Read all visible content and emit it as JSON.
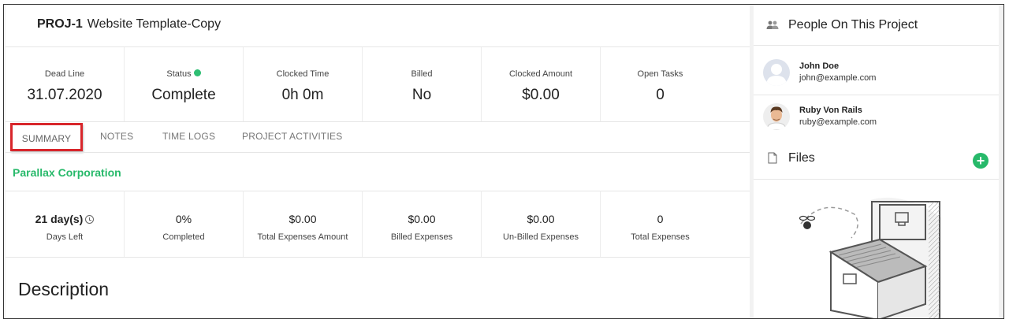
{
  "project": {
    "code": "PROJ-1",
    "name": "Website Template-Copy"
  },
  "stats": [
    {
      "label": "Dead Line",
      "value": "31.07.2020"
    },
    {
      "label": "Status",
      "value": "Complete",
      "status_color": "#2ebf73"
    },
    {
      "label": "Clocked Time",
      "value": "0h 0m"
    },
    {
      "label": "Billed",
      "value": "No"
    },
    {
      "label": "Clocked Amount",
      "value": "$0.00"
    },
    {
      "label": "Open Tasks",
      "value": "0"
    }
  ],
  "tabs": [
    {
      "label": "SUMMARY",
      "active": true
    },
    {
      "label": "NOTES"
    },
    {
      "label": "TIME LOGS"
    },
    {
      "label": "PROJECT ACTIVITIES"
    }
  ],
  "client": {
    "name": "Parallax Corporation",
    "color": "#27b96a"
  },
  "metrics": [
    {
      "value": "21 day(s)",
      "label": "Days Left",
      "icon": "clock-icon"
    },
    {
      "value": "0%",
      "label": "Completed"
    },
    {
      "value": "$0.00",
      "label": "Total Expenses Amount"
    },
    {
      "value": "$0.00",
      "label": "Billed Expenses"
    },
    {
      "value": "$0.00",
      "label": "Un-Billed Expenses"
    },
    {
      "value": "0",
      "label": "Total Expenses"
    }
  ],
  "description": {
    "heading": "Description"
  },
  "people": {
    "title": "People On This Project",
    "members": [
      {
        "name": "John Doe",
        "email": "john@example.com"
      },
      {
        "name": "Ruby Von Rails",
        "email": "ruby@example.com"
      }
    ]
  },
  "files": {
    "title": "Files",
    "add_label": "+"
  },
  "colors": {
    "accent": "#27b96a",
    "highlight": "#d8262b"
  }
}
